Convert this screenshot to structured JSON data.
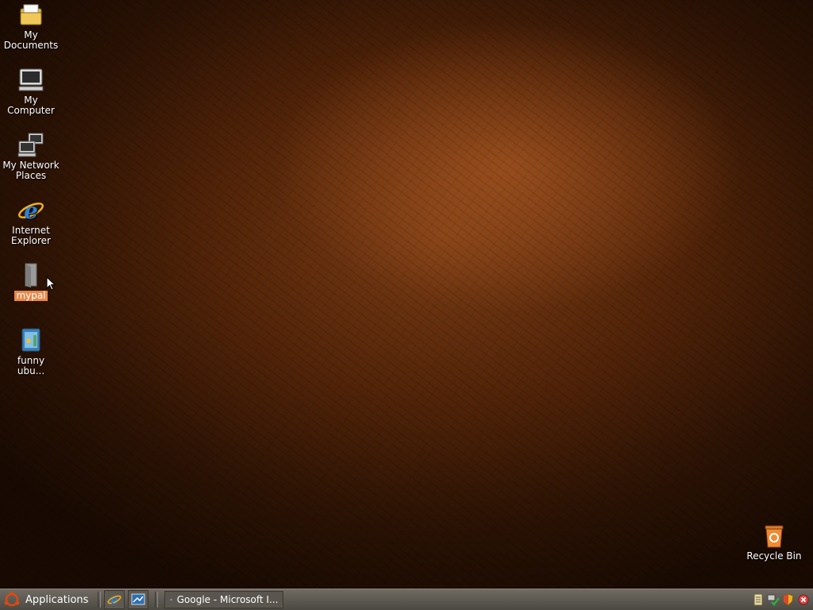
{
  "desktop": {
    "icons": [
      {
        "id": "my-documents",
        "label": "My\nDocuments",
        "icon": "folder-documents-icon"
      },
      {
        "id": "my-computer",
        "label": "My\nComputer",
        "icon": "computer-icon"
      },
      {
        "id": "my-network-places",
        "label": "My Network\nPlaces",
        "icon": "network-icon"
      },
      {
        "id": "internet-explorer",
        "label": "Internet\nExplorer",
        "icon": "internet-explorer-icon"
      },
      {
        "id": "mypal",
        "label": "mypal",
        "icon": "file-icon",
        "selected": true
      },
      {
        "id": "funny-ubu",
        "label": "funny\nubu...",
        "icon": "image-file-icon"
      }
    ],
    "recycle_bin": {
      "label": "Recycle Bin",
      "icon": "recycle-bin-icon"
    }
  },
  "taskbar": {
    "start_label": "Applications",
    "launchers": [
      "internet-explorer-icon",
      "show-desktop-icon"
    ],
    "tasks": [
      {
        "label": "Google - Microsoft I...",
        "icon": "internet-explorer-icon"
      }
    ],
    "tray": [
      "notes-icon",
      "network-status-icon",
      "security-shield-icon",
      "close-icon"
    ]
  },
  "colors": {
    "selection": "#e8874a",
    "taskbar": "#5a564f",
    "ubuntu_orange": "#dd4814"
  }
}
